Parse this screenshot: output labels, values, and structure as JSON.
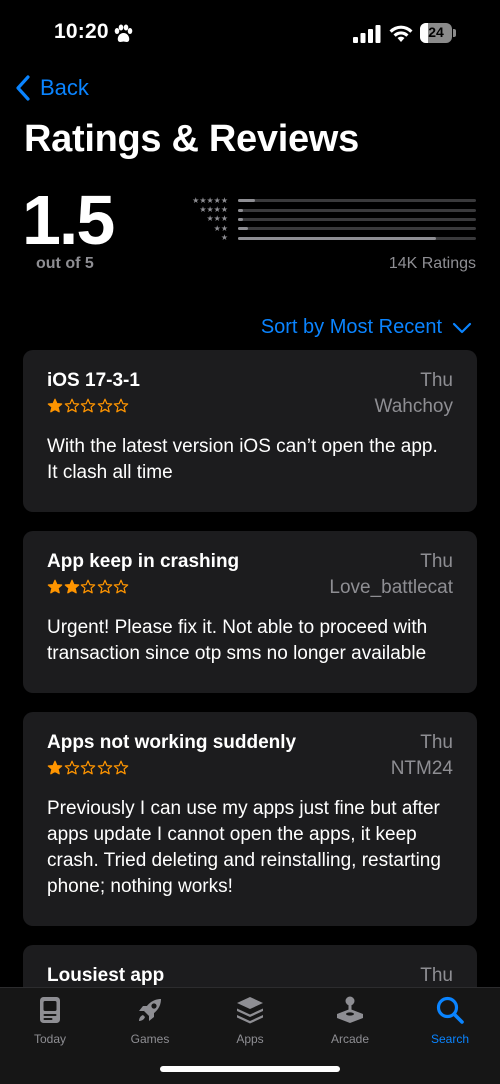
{
  "status_bar": {
    "time": "10:20",
    "battery_level": "24",
    "battery_fraction": 0.24
  },
  "nav": {
    "back_label": "Back",
    "title": "Ratings & Reviews"
  },
  "summary": {
    "average": "1.5",
    "scale": "out of 5",
    "ratings_count": "14K Ratings",
    "histogram": [
      {
        "stars": "★★★★★",
        "fraction": 0.07
      },
      {
        "stars": "★★★★",
        "fraction": 0.02
      },
      {
        "stars": "★★★",
        "fraction": 0.02
      },
      {
        "stars": "★★",
        "fraction": 0.04
      },
      {
        "stars": "★",
        "fraction": 0.83
      }
    ]
  },
  "sort": {
    "label": "Sort by Most Recent"
  },
  "reviews": [
    {
      "title": "iOS 17-3-1",
      "date": "Thu",
      "author": "Wahchoy",
      "rating": 1,
      "body": "With the latest version iOS can’t open the app. It clash all time"
    },
    {
      "title": "App keep in crashing",
      "date": "Thu",
      "author": "Love_battlecat",
      "rating": 2,
      "body": "Urgent! Please fix it. Not able to proceed with transaction since otp sms no longer available"
    },
    {
      "title": "Apps not working suddenly",
      "date": "Thu",
      "author": "NTM24",
      "rating": 1,
      "body": "Previously I can use my apps just fine but after apps update I cannot open the apps, it keep crash. Tried deleting and reinstalling, restarting phone; nothing works!"
    },
    {
      "title": "Lousiest app",
      "date": "Thu",
      "author": "",
      "rating": 0,
      "body": ""
    }
  ],
  "tab_bar": {
    "tabs": [
      {
        "label": "Today",
        "icon": "today-icon"
      },
      {
        "label": "Games",
        "icon": "rocket-icon"
      },
      {
        "label": "Apps",
        "icon": "apps-stack-icon"
      },
      {
        "label": "Arcade",
        "icon": "joystick-icon"
      },
      {
        "label": "Search",
        "icon": "search-icon"
      }
    ],
    "active": "Search"
  },
  "colors": {
    "accent": "#0a84ff",
    "star": "#ff9500",
    "card": "#1c1c1e",
    "secondary_text": "#8e8e93"
  }
}
